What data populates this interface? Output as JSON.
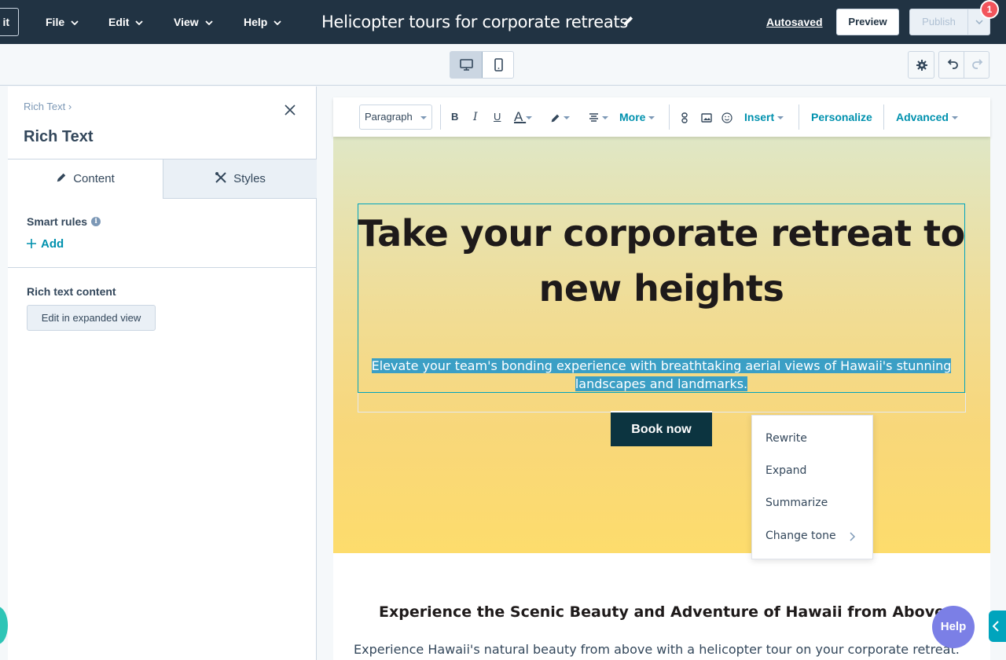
{
  "topbar": {
    "exit_label": "it",
    "menus": [
      {
        "label": "File"
      },
      {
        "label": "Edit"
      },
      {
        "label": "View"
      },
      {
        "label": "Help"
      }
    ],
    "title": "Helicopter tours for corporate retreats",
    "autosaved": "Autosaved",
    "preview": "Preview",
    "publish": "Publish",
    "notifications": "1"
  },
  "sidebar": {
    "breadcrumb": "Rich Text ›",
    "title": "Rich Text",
    "tabs": [
      {
        "label": "Content",
        "icon": "pencil-icon",
        "active": true
      },
      {
        "label": "Styles",
        "icon": "styles-icon",
        "active": false
      }
    ],
    "smart_rules": "Smart rules",
    "add": "Add",
    "rich_text_content": "Rich text content",
    "expand_button": "Edit in expanded view"
  },
  "editor_toolbar": {
    "paragraph": "Paragraph",
    "bold": "B",
    "italic": "I",
    "underline": "U",
    "text_color": "A",
    "more": "More",
    "insert": "Insert",
    "personalize": "Personalize",
    "advanced": "Advanced"
  },
  "hero": {
    "heading": "Take your corporate retreat to new heights",
    "subheading": "Elevate your team's bonding experience with breathtaking aerial views of Hawaii's stunning landscapes and landmarks.",
    "cta": "Book now"
  },
  "context_menu": {
    "items": [
      "Rewrite",
      "Expand",
      "Summarize",
      "Change tone"
    ]
  },
  "section2": {
    "title": "Experience the Scenic Beauty and Adventure of Hawaii from Above",
    "text": "Experience Hawaii's natural beauty from above with a helicopter tour on your corporate retreat."
  },
  "help": "Help",
  "colors": {
    "topbar": "#213343",
    "accent": "#0091ae",
    "selection": "#3b9fc5",
    "cta": "#0c3440",
    "help": "#7b7fe6"
  }
}
